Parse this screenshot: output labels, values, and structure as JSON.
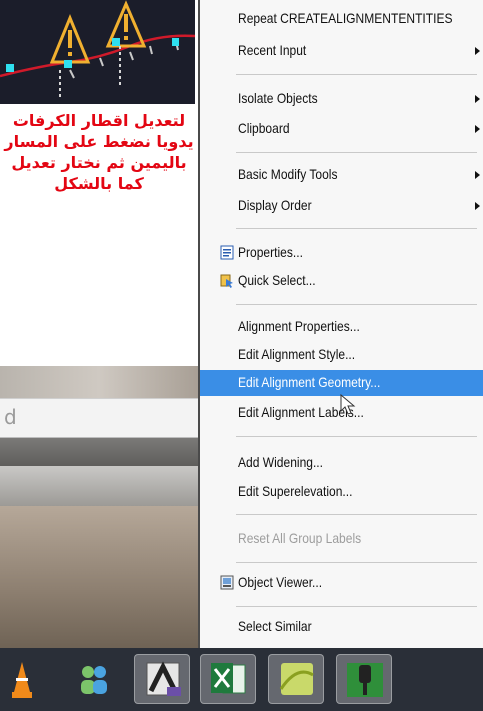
{
  "annotation": {
    "lines": [
      "لتعديل اقطار الكرفات",
      "يدويا نضغط على المسار",
      "باليمين ثم نختار تعديل",
      "كما بالشكل"
    ]
  },
  "background": {
    "input_text": "d"
  },
  "context_menu": {
    "items": [
      {
        "label": "Repeat CREATEALIGNMENTENTITIES"
      },
      {
        "label": "Recent Input"
      },
      {
        "label": "Isolate Objects"
      },
      {
        "label": "Clipboard"
      },
      {
        "label": "Basic Modify Tools"
      },
      {
        "label": "Display Order"
      },
      {
        "label": "Properties..."
      },
      {
        "label": "Quick Select..."
      },
      {
        "label": "Alignment Properties..."
      },
      {
        "label": "Edit Alignment Style..."
      },
      {
        "label": "Edit Alignment Geometry..."
      },
      {
        "label": "Edit Alignment Labels..."
      },
      {
        "label": "Add Widening..."
      },
      {
        "label": "Edit Superelevation..."
      },
      {
        "label": "Reset All Group Labels"
      },
      {
        "label": "Object Viewer..."
      },
      {
        "label": "Select Similar"
      }
    ],
    "selected_label": "Edit Alignment Geometry...",
    "disabled_label": "Reset All Group Labels"
  },
  "taskbar": {
    "apps": [
      {
        "icon": "vlc-icon"
      },
      {
        "icon": "people-icon"
      },
      {
        "icon": "autocad-icon"
      },
      {
        "icon": "excel-icon"
      },
      {
        "icon": "generic-app-icon"
      },
      {
        "icon": "gear-app-icon"
      }
    ]
  },
  "colors": {
    "annotation": "#e30613",
    "menu_highlight": "#3a8ee6",
    "viewport_bg": "#1b1d2a",
    "alignment_line": "#d01a2a",
    "grip_cyan": "#2fe0f0"
  }
}
